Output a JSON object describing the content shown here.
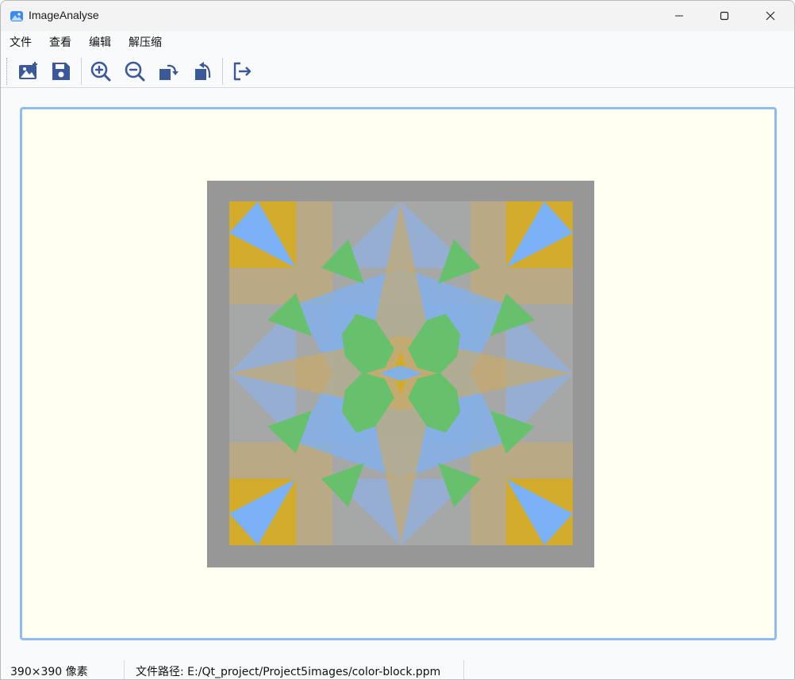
{
  "window": {
    "title": "ImageAnalyse"
  },
  "menu": {
    "items": [
      "文件",
      "查看",
      "编辑",
      "解压缩"
    ]
  },
  "toolbar": {
    "buttons": [
      {
        "icon": "open-image-icon"
      },
      {
        "icon": "save-icon"
      },
      {
        "icon": "zoom-in-icon"
      },
      {
        "icon": "zoom-out-icon"
      },
      {
        "icon": "rotate-right-icon"
      },
      {
        "icon": "rotate-left-icon"
      },
      {
        "icon": "exit-icon"
      }
    ],
    "accent_color": "#3b5998"
  },
  "colors": {
    "view_border": "#8fbbf0",
    "view_background": "#fffff2",
    "image_frame": "#979797"
  },
  "status": {
    "size": "390×390 像素",
    "path": "文件路径: E:/Qt_project/Project5images/color-block.ppm"
  }
}
